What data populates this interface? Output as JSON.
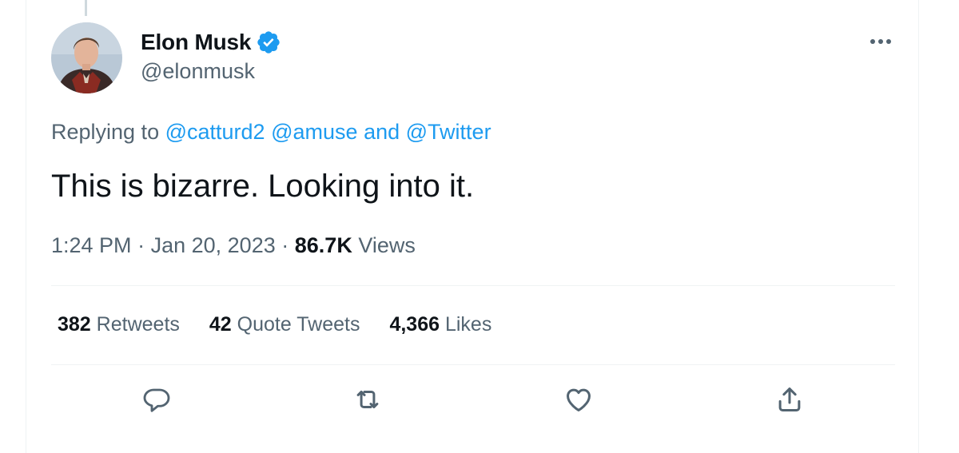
{
  "tweet": {
    "author": {
      "display_name": "Elon Musk",
      "handle": "@elonmusk",
      "verified": true,
      "avatar_icon": "avatar-photo"
    },
    "replying": {
      "prefix": "Replying to",
      "mention_1": "@catturd2",
      "mention_2": "@amuse",
      "conjunction": "and",
      "mention_3": "@Twitter"
    },
    "text": "This is bizarre. Looking into it.",
    "meta": {
      "time": "1:24 PM",
      "separator": "·",
      "date": "Jan 20, 2023",
      "views_count": "86.7K",
      "views_label": "Views"
    },
    "stats": {
      "retweets_count": "382",
      "retweets_label": "Retweets",
      "quotes_count": "42",
      "quotes_label": "Quote Tweets",
      "likes_count": "4,366",
      "likes_label": "Likes"
    },
    "actions": {
      "reply_icon": "reply-icon",
      "retweet_icon": "retweet-icon",
      "like_icon": "heart-icon",
      "share_icon": "share-icon"
    }
  },
  "colors": {
    "accent": "#1d9bf0",
    "text_primary": "#0f1419",
    "text_secondary": "#536471",
    "divider": "#eff3f4"
  }
}
